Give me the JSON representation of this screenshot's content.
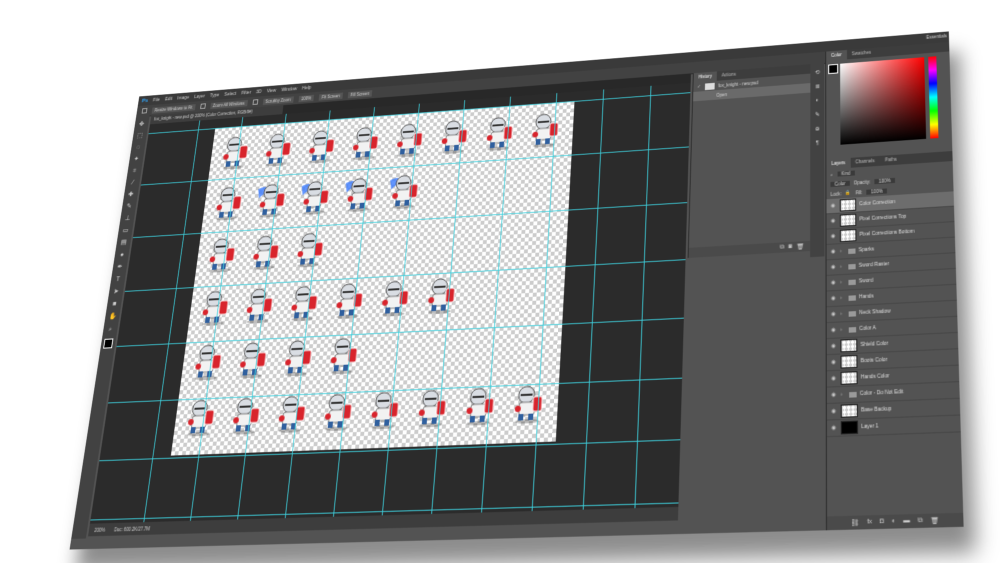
{
  "app": {
    "name": "Photoshop",
    "logo": "Ps",
    "workspace": "Essentials"
  },
  "menubar": [
    "File",
    "Edit",
    "Image",
    "Layer",
    "Type",
    "Select",
    "Filter",
    "3D",
    "View",
    "Window",
    "Help"
  ],
  "options": {
    "resize_windows": "Resize Windows to Fit",
    "zoom_all": "Zoom All Windows",
    "scrubby_zoom": "Scrubby Zoom",
    "zoom_value": "100%",
    "fit_screen": "Fit Screen",
    "fill_screen": "Fill Screen"
  },
  "document": {
    "tab_title": "fox_knight - new.psd @ 200% (Color Correction, RGB/8#)",
    "zoom": "200%",
    "doc_info": "Doc: 600.2K/27.7M"
  },
  "history": {
    "tabs": [
      "History",
      "Actions"
    ],
    "items": [
      {
        "label": "fox_knight - new.psd"
      },
      {
        "label": "Open"
      }
    ]
  },
  "color_panel": {
    "tabs": [
      "Color",
      "Swatches"
    ]
  },
  "layers_panel": {
    "tabs": [
      "Layers",
      "Channels",
      "Paths"
    ],
    "kind_filter": "Kind",
    "blend_mode": "Color",
    "opacity_label": "Opacity:",
    "opacity_value": "100%",
    "lock_label": "Lock:",
    "fill_label": "Fill:",
    "fill_value": "100%",
    "layers": [
      {
        "name": "Color Correction",
        "type": "layer",
        "selected": true,
        "thumb": "checker"
      },
      {
        "name": "Pixel Corrections Top",
        "type": "layer",
        "thumb": "checker"
      },
      {
        "name": "Pixel Corrections Bottom",
        "type": "layer",
        "thumb": "checker"
      },
      {
        "name": "Sparks",
        "type": "group"
      },
      {
        "name": "Sword Raster",
        "type": "group"
      },
      {
        "name": "Sword",
        "type": "group"
      },
      {
        "name": "Hands",
        "type": "group"
      },
      {
        "name": "Neck Shadow",
        "type": "group"
      },
      {
        "name": "Color A",
        "type": "group"
      },
      {
        "name": "Shield Color",
        "type": "layer",
        "thumb": "checker"
      },
      {
        "name": "Boots Color",
        "type": "layer",
        "thumb": "checker"
      },
      {
        "name": "Hands Color",
        "type": "layer",
        "thumb": "checker"
      },
      {
        "name": "Color - Do Not Edit",
        "type": "group"
      },
      {
        "name": "Base Backup",
        "type": "layer",
        "thumb": "checker"
      },
      {
        "name": "Layer 1",
        "type": "layer",
        "thumb": "black"
      }
    ]
  },
  "sprite_sheet": {
    "rows": [
      8,
      5,
      3,
      6,
      4,
      8
    ]
  },
  "colors": {
    "knight_armor": "#d9dde3",
    "knight_red": "#d8242c",
    "knight_blue": "#2f5f9e",
    "spark_blue": "#3a7bff",
    "guide": "#3ed0dd"
  }
}
